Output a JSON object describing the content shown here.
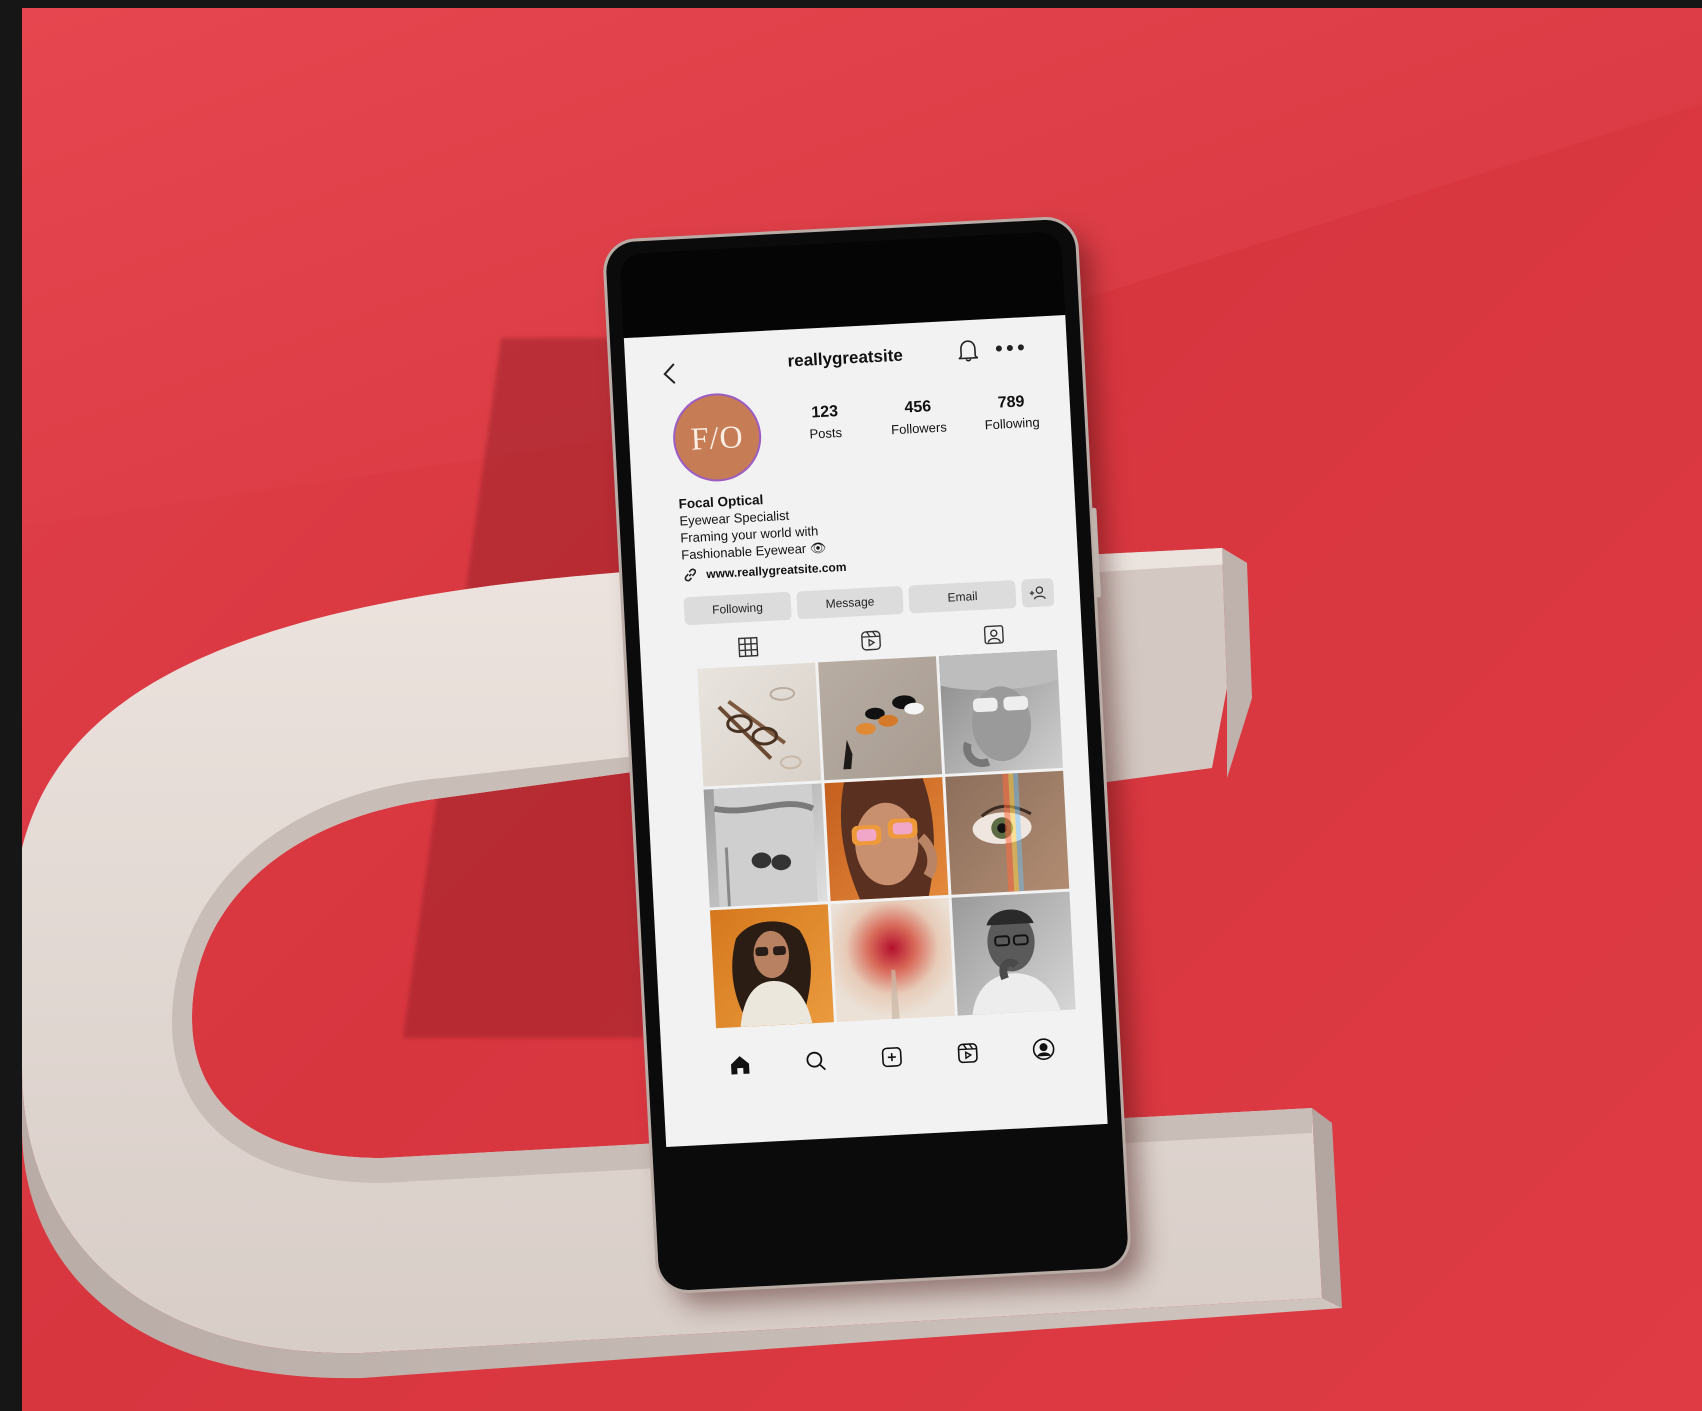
{
  "profile": {
    "username": "reallygreatsite",
    "avatar_initials": "F/O",
    "stats": [
      {
        "value": "123",
        "label": "Posts"
      },
      {
        "value": "456",
        "label": "Followers"
      },
      {
        "value": "789",
        "label": "Following"
      }
    ],
    "bio": {
      "name": "Focal Optical",
      "lines": [
        "Eyewear Specialist",
        "Framing your world with",
        "Fashionable Eyewear 👁"
      ]
    },
    "website": "www.reallygreatsite.com"
  },
  "actions": {
    "following_label": "Following",
    "message_label": "Message",
    "email_label": "Email"
  },
  "icons": {
    "back": "chevron-left-icon",
    "bell": "bell-icon",
    "more": "more-dots-icon",
    "link": "link-icon",
    "add_person": "add-person-icon",
    "grid_tab": "grid-icon",
    "reels_tab": "reels-icon",
    "tagged_tab": "tagged-icon",
    "nav": [
      "home-icon",
      "search-icon",
      "add-post-icon",
      "reels-icon",
      "profile-icon"
    ]
  },
  "posts": [
    {
      "subject": "glasses on table"
    },
    {
      "subject": "sunglasses on sand"
    },
    {
      "subject": "woman with white sunglasses"
    },
    {
      "subject": "glasses in pocket"
    },
    {
      "subject": "woman with orange sunglasses"
    },
    {
      "subject": "eye close-up with rainbow"
    },
    {
      "subject": "woman with curly hair"
    },
    {
      "subject": "blurred red flower"
    },
    {
      "subject": "man portrait"
    }
  ],
  "colors": {
    "background_red": "#dc3c45",
    "avatar": "#c67c55",
    "avatar_ring": "#9b5cc4",
    "screen": "#f2f2f2",
    "button": "#dcdcdc"
  }
}
